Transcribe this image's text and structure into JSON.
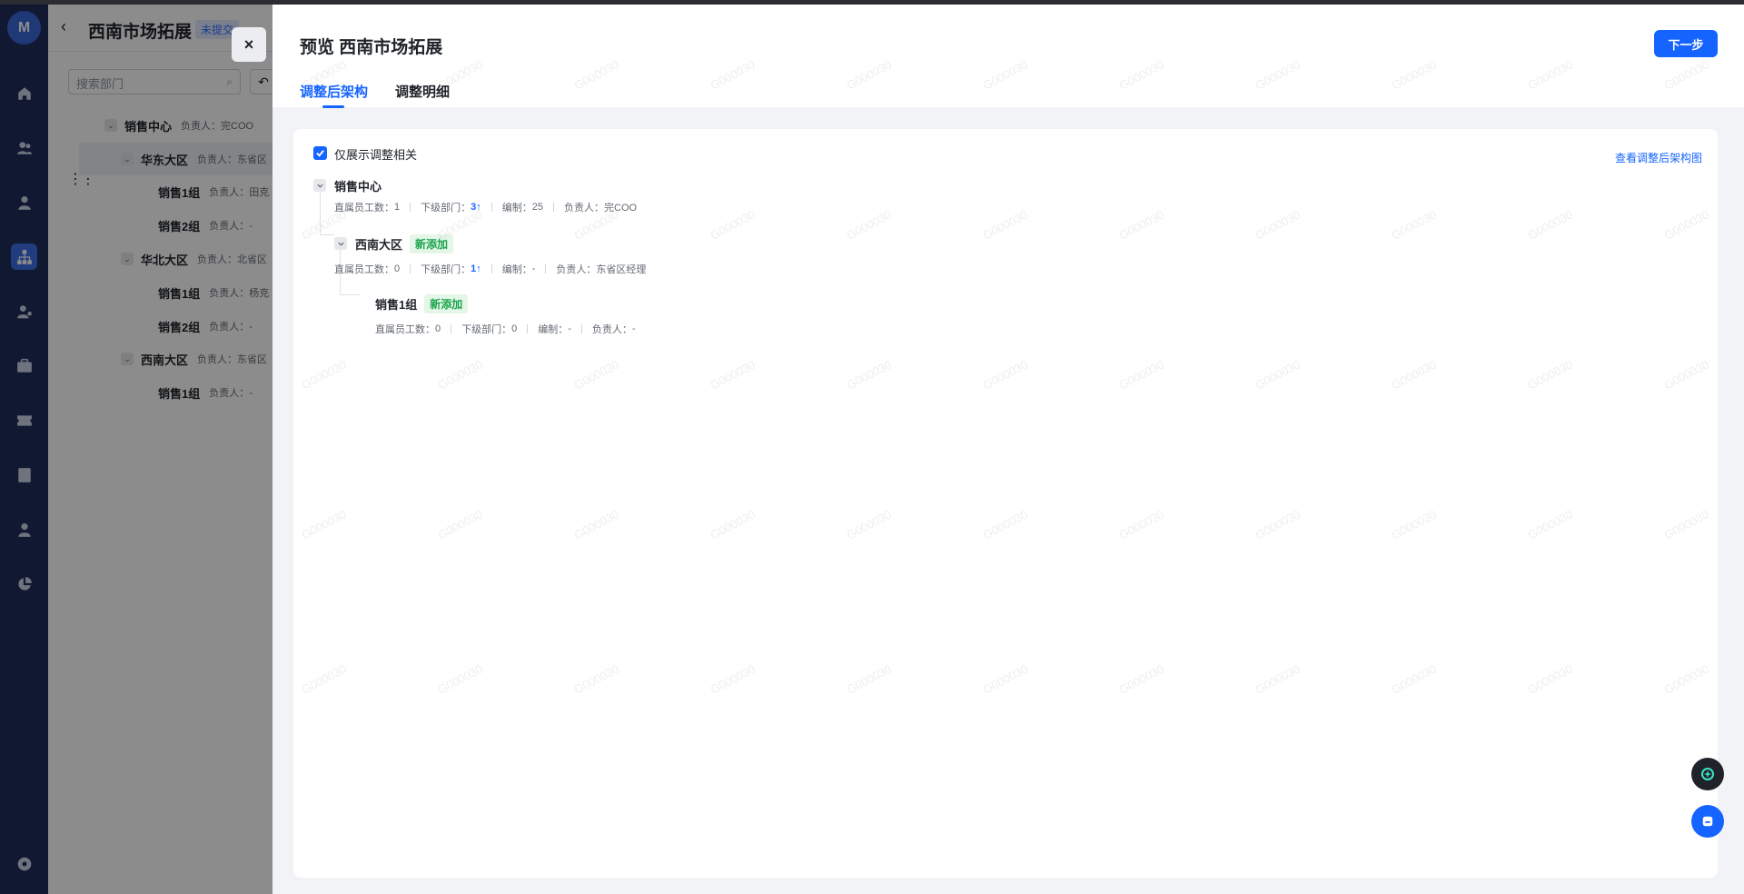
{
  "background_page": {
    "title": "西南市场拓展",
    "status_badge": "未提交",
    "search_placeholder": "搜索部门",
    "tree": [
      {
        "name": "销售中心",
        "owner": "负责人：完COO"
      },
      {
        "name": "华东大区",
        "owner": "负责人：东省区"
      },
      {
        "name": "销售1组",
        "owner": "负责人：田克"
      },
      {
        "name": "销售2组",
        "owner": "负责人：-"
      },
      {
        "name": "华北大区",
        "owner": "负责人：北省区"
      },
      {
        "name": "销售1组",
        "owner": "负责人：杨克"
      },
      {
        "name": "销售2组",
        "owner": "负责人：-"
      },
      {
        "name": "西南大区",
        "owner": "负责人：东省区"
      },
      {
        "name": "销售1组",
        "owner": "负责人：-"
      }
    ]
  },
  "drawer": {
    "close_label": "×",
    "title": "预览 西南市场拓展",
    "next_label": "下一步",
    "tabs": [
      {
        "label": "调整后架构",
        "active": true
      },
      {
        "label": "调整明细",
        "active": false
      }
    ],
    "filter_label": "仅展示调整相关",
    "view_link": "查看调整后架构图",
    "tree": {
      "root": {
        "name": "销售中心",
        "meta": {
          "direct_label": "直属员工数：",
          "direct": "1",
          "sub_label": "下级部门：",
          "sub": "3↑",
          "quota_label": "编制：",
          "quota": "25",
          "owner_label": "负责人：",
          "owner": "完COO"
        }
      },
      "level1": {
        "name": "西南大区",
        "tag": "新添加",
        "meta": {
          "direct_label": "直属员工数：",
          "direct": "0",
          "sub_label": "下级部门：",
          "sub": "1↑",
          "quota_label": "编制：",
          "quota": "-",
          "owner_label": "负责人：",
          "owner": "东省区经理"
        }
      },
      "level2": {
        "name": "销售1组",
        "tag": "新添加",
        "meta": {
          "direct_label": "直属员工数：",
          "direct": "0",
          "sub_label": "下级部门：",
          "sub": "0",
          "quota_label": "编制：",
          "quota": "-",
          "owner_label": "负责人：",
          "owner": "-"
        }
      }
    },
    "watermark": "G000030"
  },
  "colors": {
    "accent": "#1664ff",
    "new_tag_text": "#1aa34a",
    "new_tag_bg": "#e3f6e8",
    "rail_bg": "#1f2e5c"
  },
  "nav_icons": [
    "home-icon",
    "team-icon",
    "user-icon",
    "org-chart-icon",
    "user-settings-icon",
    "briefcase-icon",
    "ticket-icon",
    "report-icon",
    "profile-icon",
    "pie-chart-icon",
    "settings-icon"
  ]
}
